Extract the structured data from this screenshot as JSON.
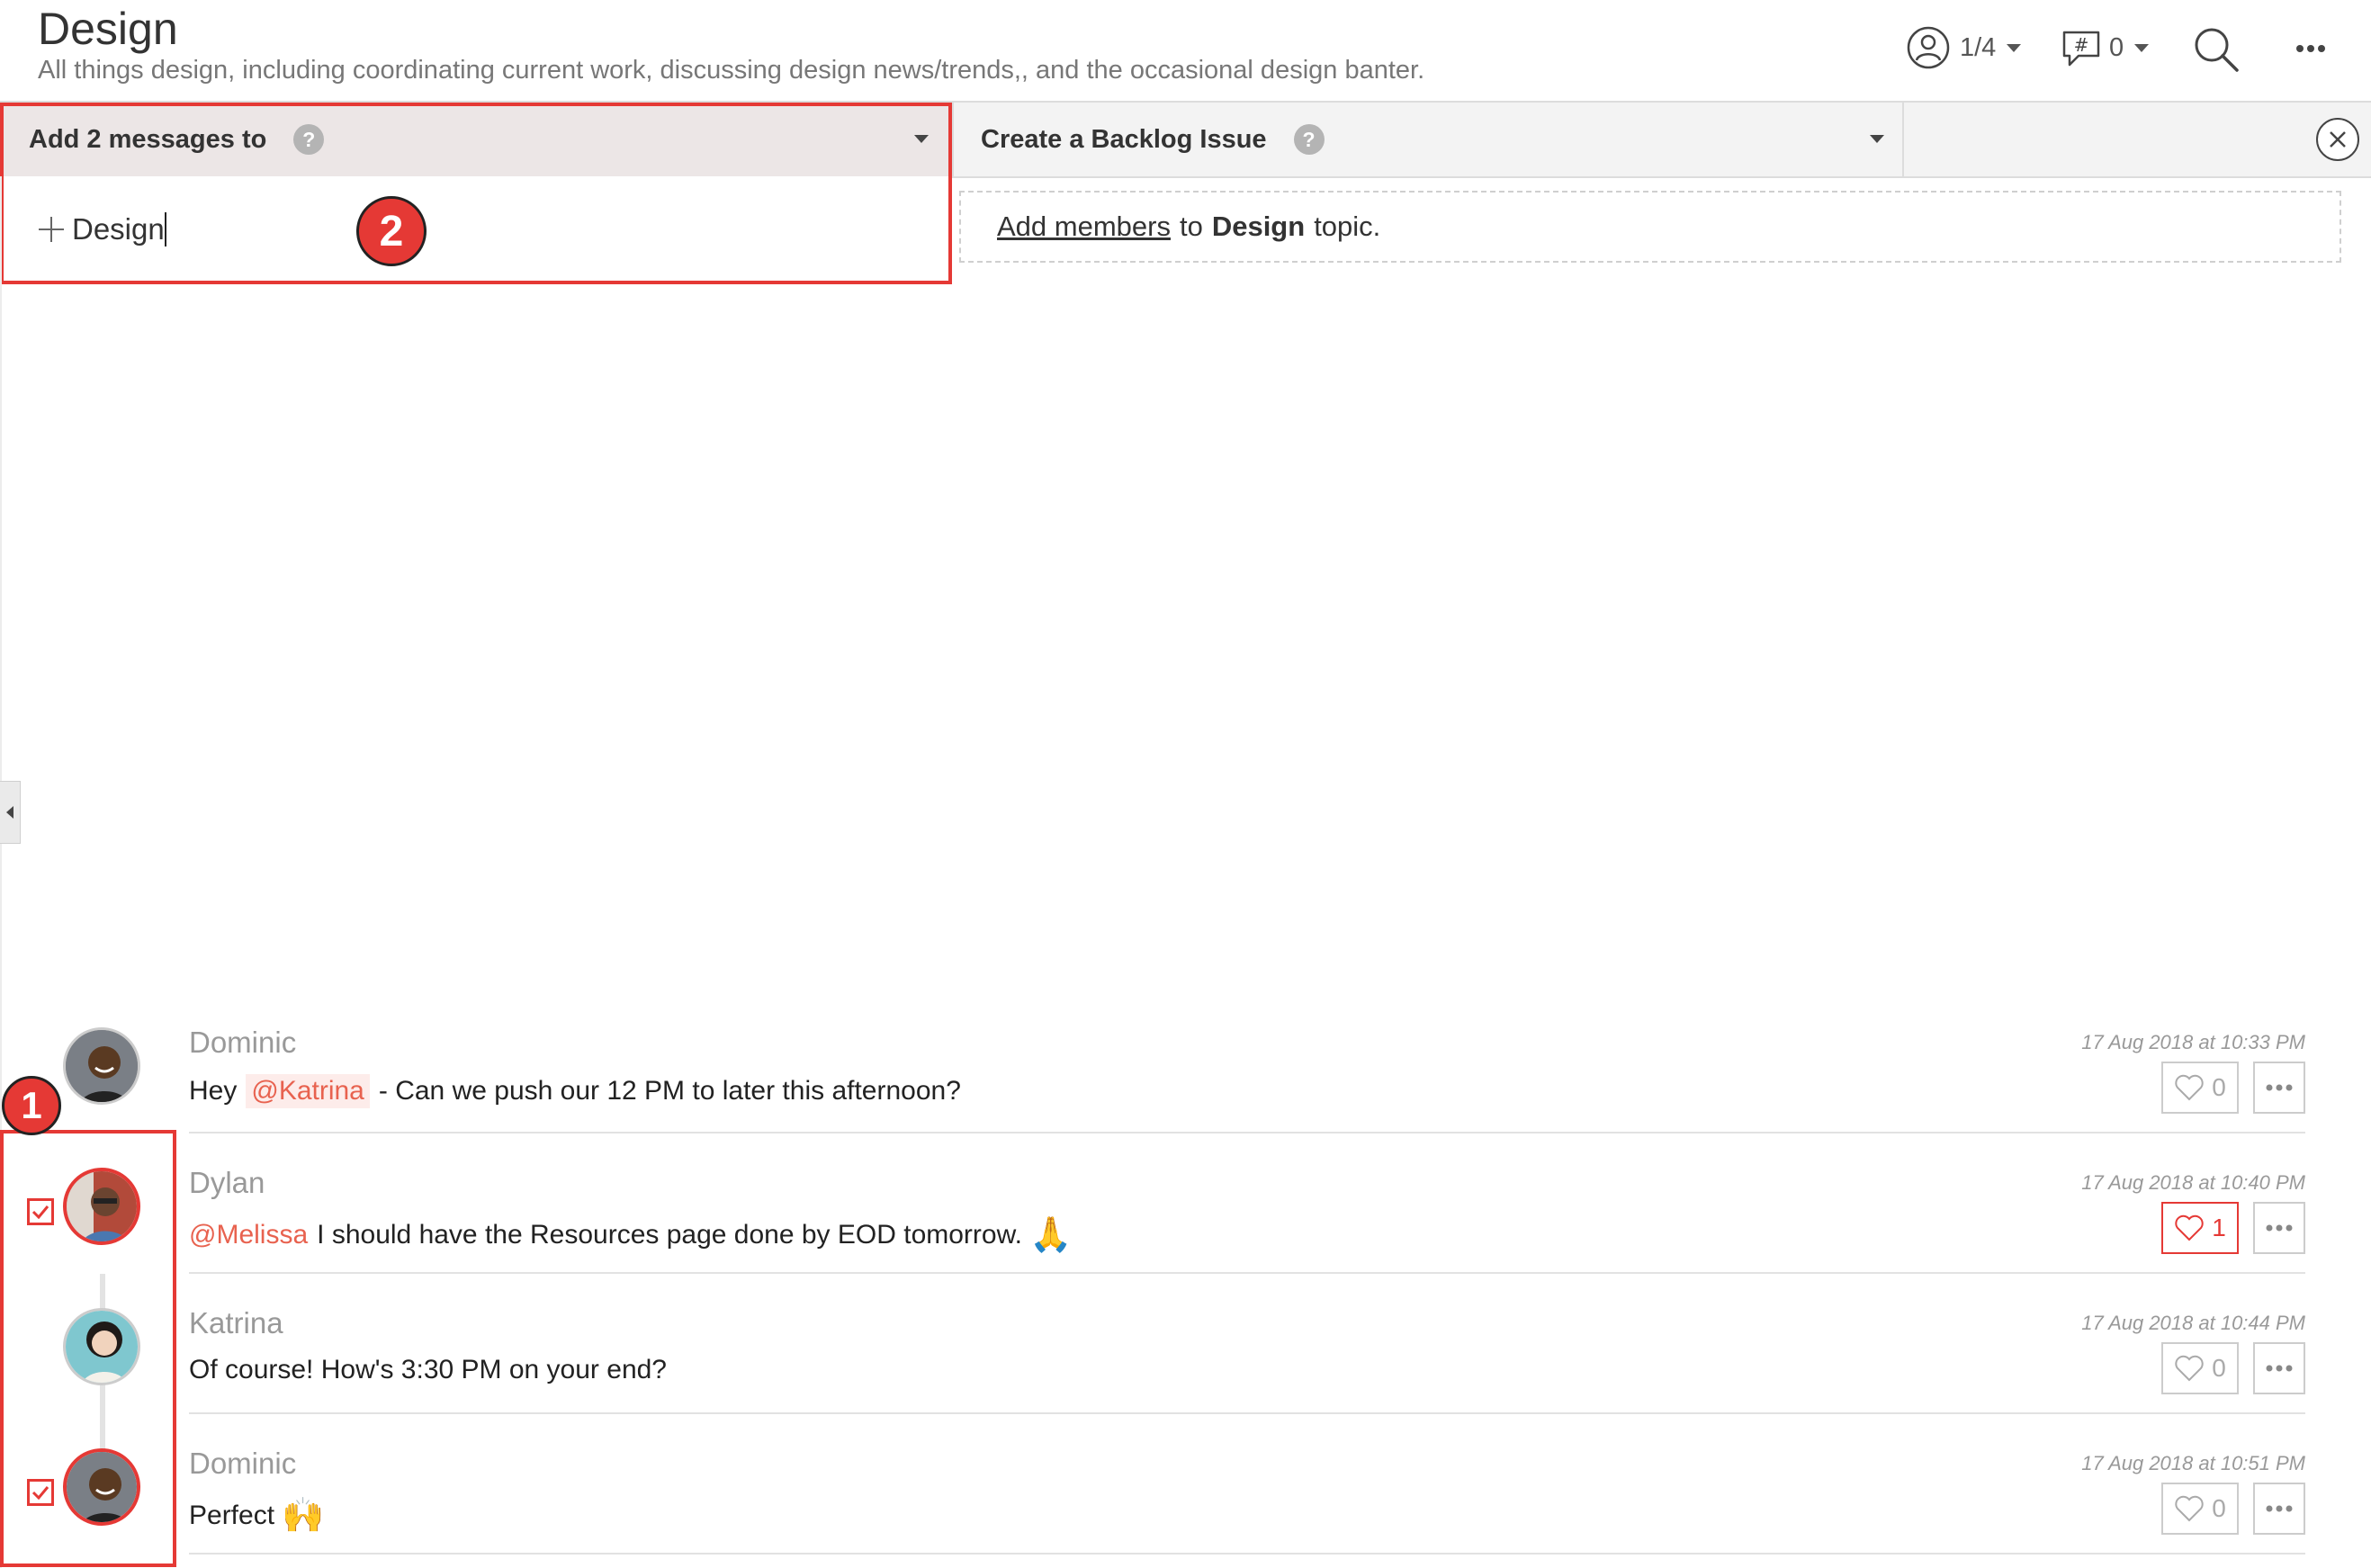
{
  "header": {
    "title": "Design",
    "subtitle": "All things design, including coordinating current work, discussing design news/trends,, and the occasional design banter.",
    "members_count": "1/4",
    "topics_count": "0",
    "icons": [
      "members-icon",
      "topics-icon",
      "search-icon",
      "more-icon"
    ]
  },
  "action_bar": {
    "add_messages_label": "Add 2 messages to",
    "help_glyph": "?",
    "selected_topic": "Design",
    "backlog_label": "Create a Backlog Issue",
    "add_members_link": "Add members",
    "add_members_mid": "to",
    "add_members_topic": "Design",
    "add_members_suffix": "topic."
  },
  "annotations": {
    "badge_1": "1",
    "badge_2": "2"
  },
  "messages": [
    {
      "author": "Dominic",
      "time": "17 Aug 2018 at 10:33 PM",
      "text_prefix": "Hey",
      "mention": "@Katrina",
      "text": "- Can we push our 12 PM to later this afternoon?",
      "likes": "0",
      "liked": false,
      "selected": false
    },
    {
      "author": "Dylan",
      "time": "17 Aug 2018 at 10:40 PM",
      "mention": "@Melissa",
      "text": "I should have the Resources page done by EOD tomorrow.",
      "emoji": "🙏",
      "likes": "1",
      "liked": true,
      "selected": true
    },
    {
      "author": "Katrina",
      "time": "17 Aug 2018 at 10:44 PM",
      "text": "Of course! How's 3:30 PM on your end?",
      "likes": "0",
      "liked": false,
      "selected": false
    },
    {
      "author": "Dominic",
      "time": "17 Aug 2018 at 10:51 PM",
      "text": "Perfect",
      "emoji": "🙌",
      "likes": "0",
      "liked": false,
      "selected": true
    }
  ],
  "colors": {
    "accent": "#e53935",
    "mention": "#e8624f",
    "name": "#999999"
  }
}
